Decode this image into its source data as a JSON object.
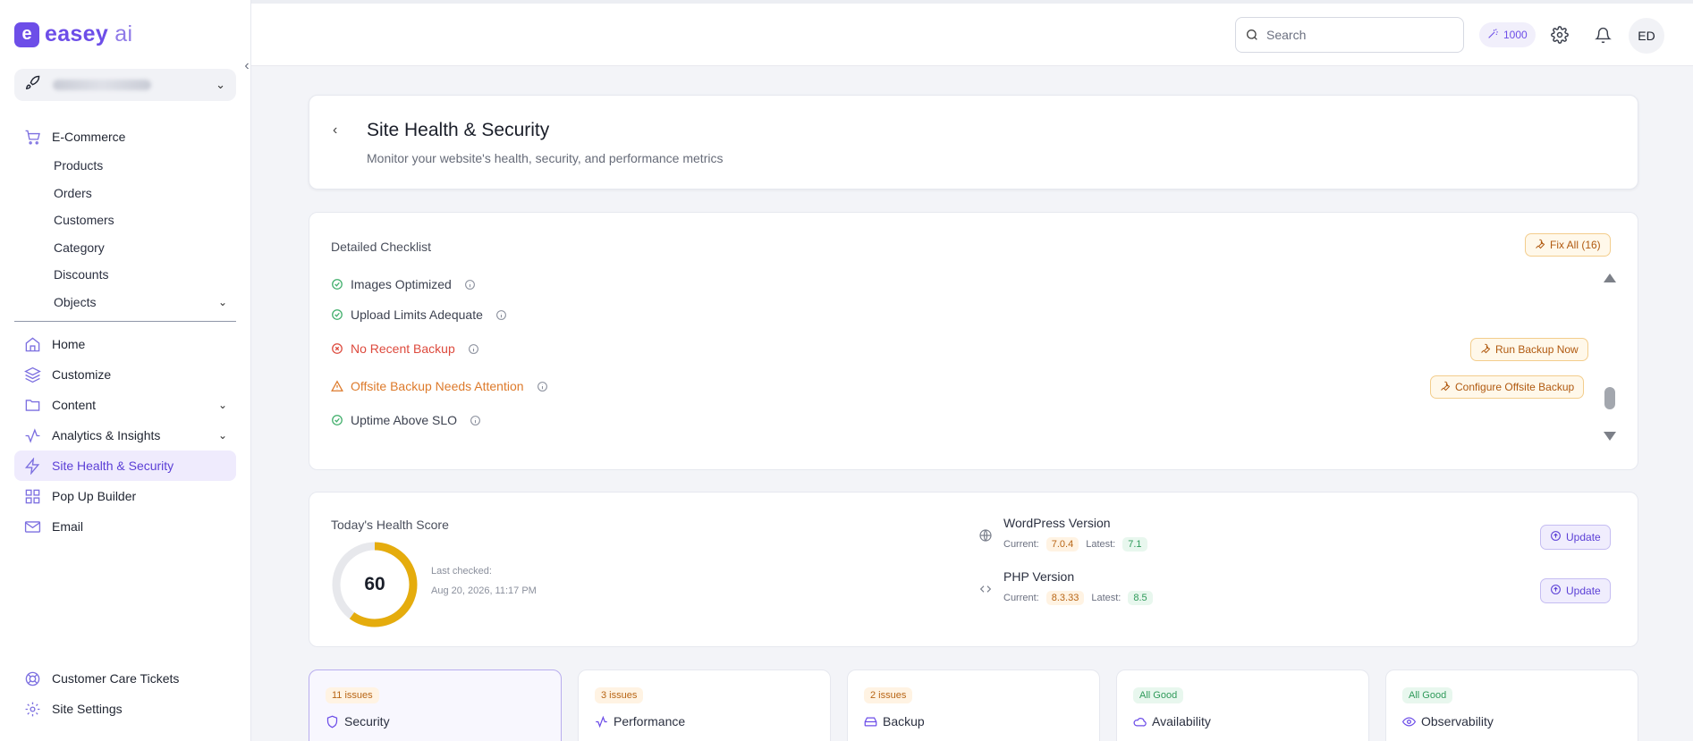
{
  "brand": {
    "logo_letter": "e",
    "name_main": "easey",
    "name_suffix": " ai"
  },
  "site_selector": {
    "label": ""
  },
  "sidebar": {
    "ecommerce": {
      "label": "E-Commerce",
      "children": [
        "Products",
        "Orders",
        "Customers",
        "Category",
        "Discounts",
        "Objects"
      ]
    },
    "items": [
      {
        "label": "Home",
        "icon": "home-icon"
      },
      {
        "label": "Customize",
        "icon": "layers-icon"
      },
      {
        "label": "Content",
        "icon": "folder-icon"
      },
      {
        "label": "Analytics & Insights",
        "icon": "activity-icon"
      },
      {
        "label": "Site Health & Security",
        "icon": "zap-icon"
      },
      {
        "label": "Pop Up Builder",
        "icon": "grid-icon"
      },
      {
        "label": "Email",
        "icon": "mail-icon"
      }
    ],
    "bottom_items": [
      {
        "label": "Customer Care Tickets",
        "icon": "lifebuoy-icon"
      },
      {
        "label": "Site Settings",
        "icon": "gear-icon"
      }
    ]
  },
  "topbar": {
    "search_placeholder": "Search",
    "credits": "1000",
    "avatar_initials": "ED"
  },
  "header": {
    "title": "Site Health & Security",
    "subtitle": "Monitor your website's health, security, and performance metrics"
  },
  "checklist": {
    "title": "Detailed Checklist",
    "fix_all_label": "Fix All (16)",
    "rows": [
      {
        "label": "Images Optimized",
        "status": "ok"
      },
      {
        "label": "Upload Limits Adequate",
        "status": "ok"
      },
      {
        "label": "No Recent Backup",
        "status": "error",
        "action": "Run Backup Now"
      },
      {
        "label": "Offsite Backup Needs Attention",
        "status": "warning",
        "action": "Configure Offsite Backup"
      },
      {
        "label": "Uptime Above SLO",
        "status": "ok"
      }
    ]
  },
  "health": {
    "title": "Today's Health Score",
    "score": "60",
    "score_fraction": 0.6,
    "last_checked_label": "Last checked:",
    "last_checked_value": "Aug 20, 2026, 11:17 PM",
    "versions": [
      {
        "name": "WordPress Version",
        "current_label": "Current:",
        "current": "7.0.4",
        "latest_label": "Latest:",
        "latest": "7.1",
        "action": "Update"
      },
      {
        "name": "PHP Version",
        "current_label": "Current:",
        "current": "8.3.33",
        "latest_label": "Latest:",
        "latest": "8.5",
        "action": "Update"
      }
    ]
  },
  "categories": [
    {
      "badge": "11 issues",
      "label": "Security",
      "tone": "orange"
    },
    {
      "badge": "3 issues",
      "label": "Performance",
      "tone": "orange"
    },
    {
      "badge": "2 issues",
      "label": "Backup",
      "tone": "orange"
    },
    {
      "badge": "All Good",
      "label": "Availability",
      "tone": "green"
    },
    {
      "badge": "All Good",
      "label": "Observability",
      "tone": "green"
    }
  ],
  "colors": {
    "accent": "#6d4ee8",
    "gauge": "#e5ac0d",
    "error": "#dd4a3d",
    "warning": "#dd7a2b",
    "ok": "#3fae6a"
  }
}
